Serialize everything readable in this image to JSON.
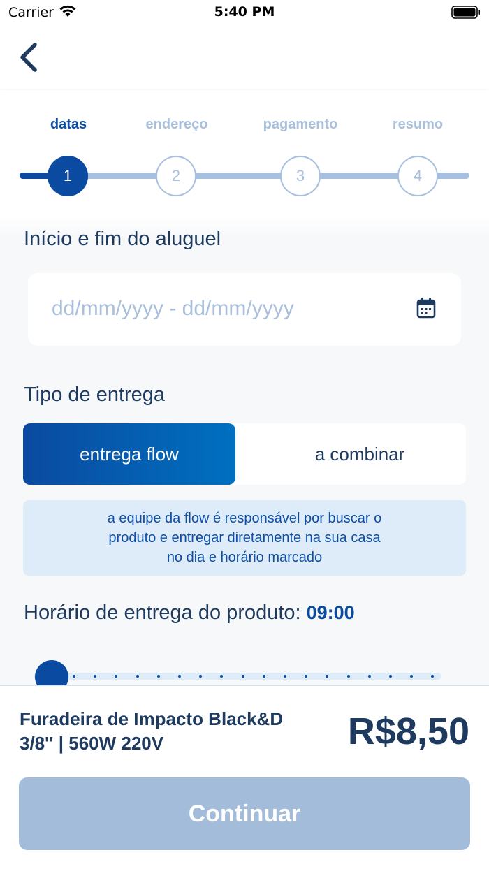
{
  "status_bar": {
    "carrier": "Carrier",
    "time": "5:40 PM"
  },
  "colors": {
    "primary": "#0a4aa0",
    "inactive": "#a7c0df",
    "text": "#1e3a5f",
    "info_bg": "#deebf9",
    "button_disabled": "#a3bcda"
  },
  "steps": [
    {
      "label": "datas",
      "number": "1",
      "active": true
    },
    {
      "label": "endereço",
      "number": "2",
      "active": false
    },
    {
      "label": "pagamento",
      "number": "3",
      "active": false
    },
    {
      "label": "resumo",
      "number": "4",
      "active": false
    }
  ],
  "rental": {
    "title": "Início e fim do aluguel",
    "placeholder": "dd/mm/yyyy - dd/mm/yyyy",
    "icon": "calendar-icon"
  },
  "delivery": {
    "title": "Tipo de entrega",
    "options": [
      "entrega flow",
      "a combinar"
    ],
    "selected": "entrega flow",
    "info_lines": [
      "a equipe da flow é responsável por buscar o",
      "produto e entregar diretamente na sua casa",
      "no dia e horário marcado"
    ]
  },
  "time": {
    "label": "Horário de entrega do produto:",
    "value": "09:00",
    "slider_position": 0.0
  },
  "footer": {
    "product_name_line1": "Furadeira de Impacto Black&D",
    "product_name_line2": "3/8'' | 560W 220V",
    "price": "R$8,50",
    "continue_label": "Continuar"
  }
}
